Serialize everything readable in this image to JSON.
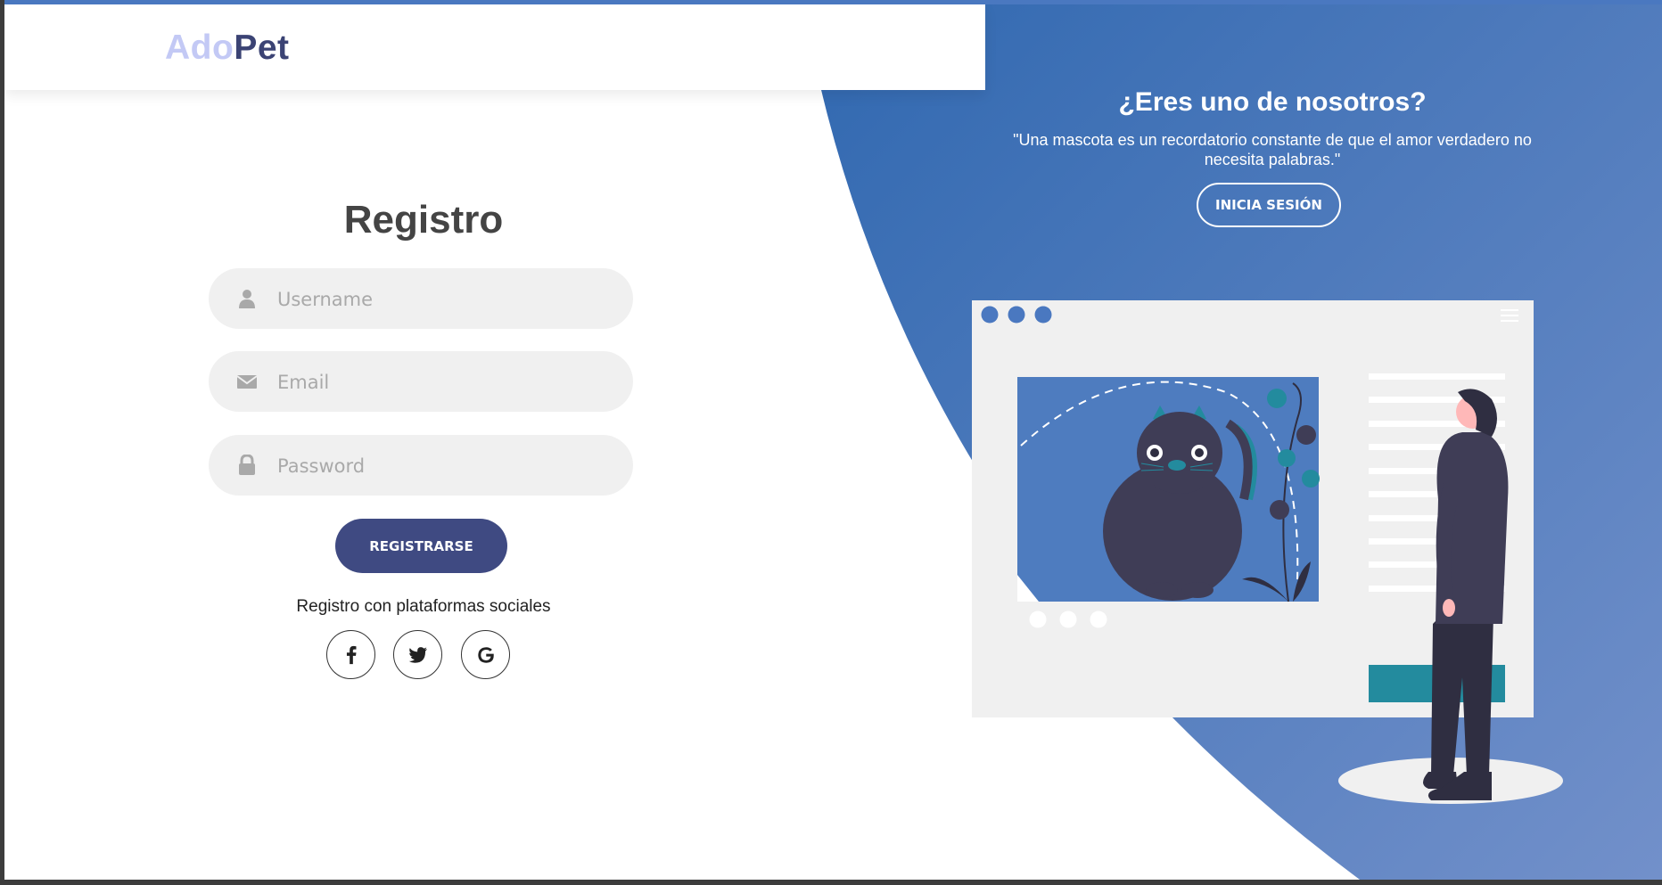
{
  "brand": {
    "part1": "Ado",
    "part2": "Pet"
  },
  "signup": {
    "title": "Registro",
    "username_placeholder": "Username",
    "email_placeholder": "Email",
    "password_placeholder": "Password",
    "submit_label": "REGISTRARSE",
    "social_text": "Registro con plataformas sociales",
    "social_icons": [
      "facebook-icon",
      "twitter-icon",
      "google-icon"
    ]
  },
  "panel": {
    "title": "¿Eres uno de nosotros?",
    "quote": "\"Una mascota es un recordatorio constante de que el amor verdadero no necesita palabras.\"",
    "login_label": "INICIA SESIÓN"
  },
  "colors": {
    "accent_dark": "#3f4a82",
    "brand_light": "#c3c9f5",
    "panel_blue_start": "#3068b0",
    "panel_blue_end": "#7290ca",
    "teal": "#238b9e"
  }
}
